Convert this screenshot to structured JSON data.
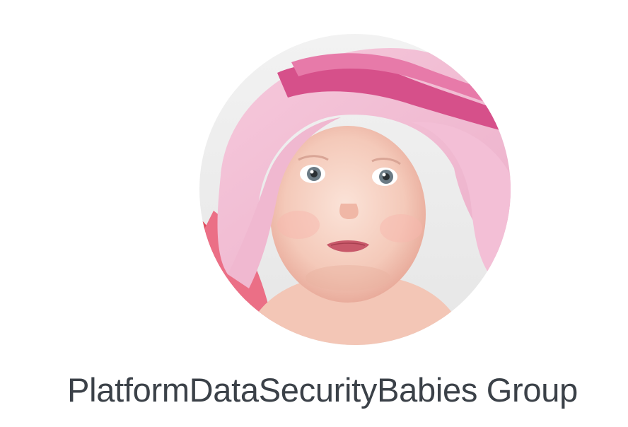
{
  "group": {
    "name": "PlatformDataSecurityBabies Group",
    "avatar_icon": "group-avatar-photo"
  },
  "colors": {
    "background": "#ffffff",
    "text": "#3b4148",
    "towel_pink": "#e8a6c4",
    "towel_magenta": "#d6508a"
  }
}
